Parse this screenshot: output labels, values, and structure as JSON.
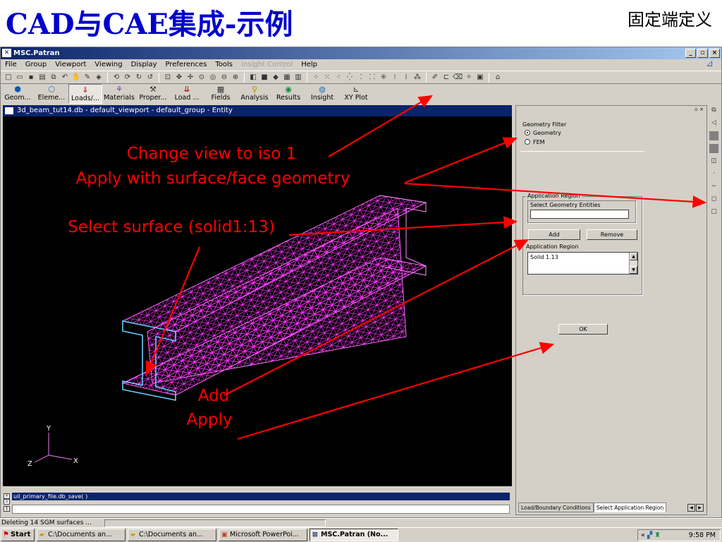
{
  "slide": {
    "title": "CAD与CAE集成-示例",
    "subtitle": "固定端定义"
  },
  "window": {
    "title": "MSC.Patran",
    "controls": [
      "_",
      "▫",
      "×"
    ]
  },
  "menu": {
    "items": [
      "File",
      "Group",
      "Viewport",
      "Viewing",
      "Display",
      "Preferences",
      "Tools"
    ],
    "disabled_item": "Insight Control",
    "help": "Help"
  },
  "app_toolbar": {
    "buttons": [
      {
        "label": "Geom...",
        "icon": "geometry-icon"
      },
      {
        "label": "Eleme...",
        "icon": "elements-icon"
      },
      {
        "label": "Loads/...",
        "icon": "loads-icon"
      },
      {
        "label": "Materials",
        "icon": "materials-icon"
      },
      {
        "label": "Proper...",
        "icon": "properties-icon"
      },
      {
        "label": "Load ...",
        "icon": "load-cases-icon"
      },
      {
        "label": "Fields",
        "icon": "fields-icon"
      },
      {
        "label": "Analysis",
        "icon": "analysis-icon"
      },
      {
        "label": "Results",
        "icon": "results-icon"
      },
      {
        "label": "Insight",
        "icon": "insight-icon"
      },
      {
        "label": "XY Plot",
        "icon": "xy-plot-icon"
      }
    ],
    "active": "Loads/..."
  },
  "viewport": {
    "title": "3d_beam_tut14.db - default_viewport - default_group - Entity",
    "axes": {
      "y": "Y",
      "z": "Z",
      "x": "X"
    }
  },
  "command": {
    "history": "uil_primary_file.db_save( )",
    "input": ""
  },
  "panel": {
    "geometry_filter_label": "Geometry Filter",
    "geometry_option": "Geometry",
    "fem_option": "FEM",
    "selected_filter": "Geometry",
    "application_region_title": "Application Region",
    "select_entities_label": "Select Geometry Entities",
    "select_entities_value": "",
    "add_button": "Add",
    "remove_button": "Remove",
    "region_list_label": "Application Region",
    "region_list_items": [
      "Solid 1.13"
    ],
    "ok_button": "OK",
    "tabs": [
      "Load/Boundary Conditions",
      "Select Application Region"
    ],
    "active_tab": "Select Application Region"
  },
  "status": {
    "message": "Deleting 14 SGM surfaces ..."
  },
  "taskbar": {
    "start": "Start",
    "items": [
      {
        "label": "C:\\Documents an...",
        "icon": "folder-icon"
      },
      {
        "label": "C:\\Documents an...",
        "icon": "folder-icon"
      },
      {
        "label": "Microsoft PowerPoi...",
        "icon": "powerpoint-icon"
      },
      {
        "label": "MSC.Patran (No...",
        "icon": "patran-icon"
      }
    ],
    "active": "MSC.Patran (No...",
    "tray_prefix": "«",
    "clock": "9:58 PM"
  },
  "annotations": {
    "view_line1": "Change view to iso 1",
    "view_line2": "Apply with surface/face geometry",
    "select_surface": "Select surface (solid1:13)",
    "add": "Add",
    "apply": "Apply"
  },
  "colors": {
    "annotation_red": "#ff0000",
    "mesh_magenta": "#ff00ff",
    "edge_cyan": "#66ccff",
    "title_blue": "#0000cc",
    "titlebar_navy": "#0a246a",
    "window_gray": "#d4d0c8"
  }
}
